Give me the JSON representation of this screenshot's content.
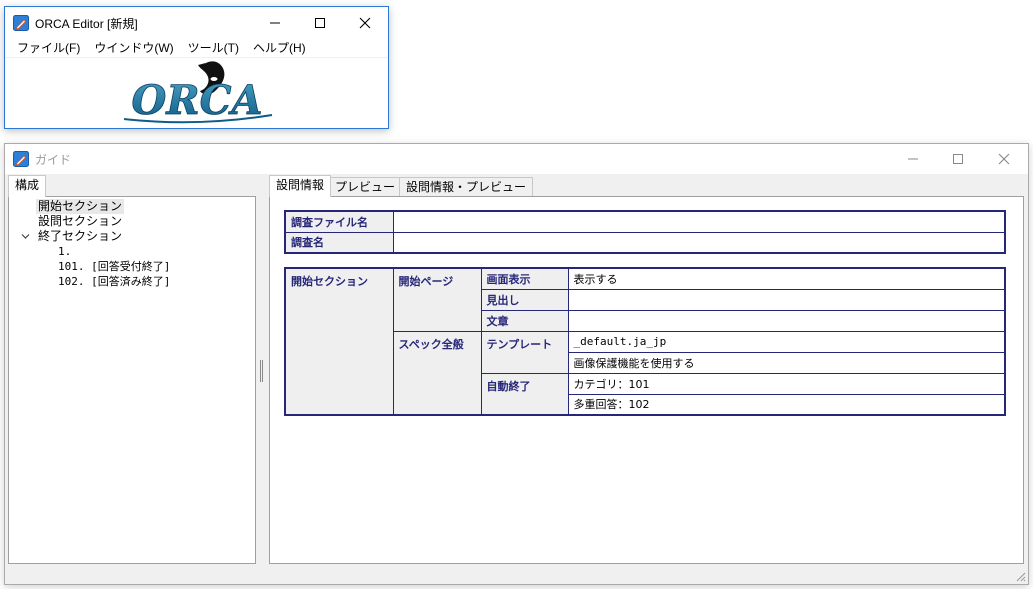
{
  "editor_window": {
    "title": "ORCA Editor [新規]",
    "menu": [
      "ファイル(F)",
      "ウインドウ(W)",
      "ツール(T)",
      "ヘルプ(H)"
    ],
    "logo_text": "ORCA"
  },
  "guide_window": {
    "title": "ガイド",
    "left_tab": "構成",
    "tree": [
      {
        "label": "開始セクション",
        "selected": true
      },
      {
        "label": "設問セクション"
      },
      {
        "label": "終了セクション",
        "expanded": true
      },
      {
        "label": "1."
      },
      {
        "label": "101. [回答受付終了]"
      },
      {
        "label": "102. [回答済み終了]"
      }
    ],
    "tabs": [
      "設問情報",
      "プレビュー",
      "設問情報・プレビュー"
    ],
    "survey_table": {
      "file_label": "調査ファイル名",
      "file_value": "",
      "name_label": "調査名",
      "name_value": ""
    },
    "section_table": {
      "section": "開始セクション",
      "group1": "開始ページ",
      "g1_rows": [
        {
          "key": "画面表示",
          "value": "表示する"
        },
        {
          "key": "見出し",
          "value": ""
        },
        {
          "key": "文章",
          "value": ""
        }
      ],
      "group2": "スペック全般",
      "template_key": "テンプレート",
      "template_values": [
        "_default.ja_jp",
        "画像保護機能を使用する"
      ],
      "auto_key": "自動終了",
      "auto_values": [
        "カテゴリ：101",
        "多重回答：102"
      ]
    }
  },
  "colors": {
    "accent": "#27277a",
    "window_border": "#2b79d7",
    "header_bg": "#efefef"
  }
}
